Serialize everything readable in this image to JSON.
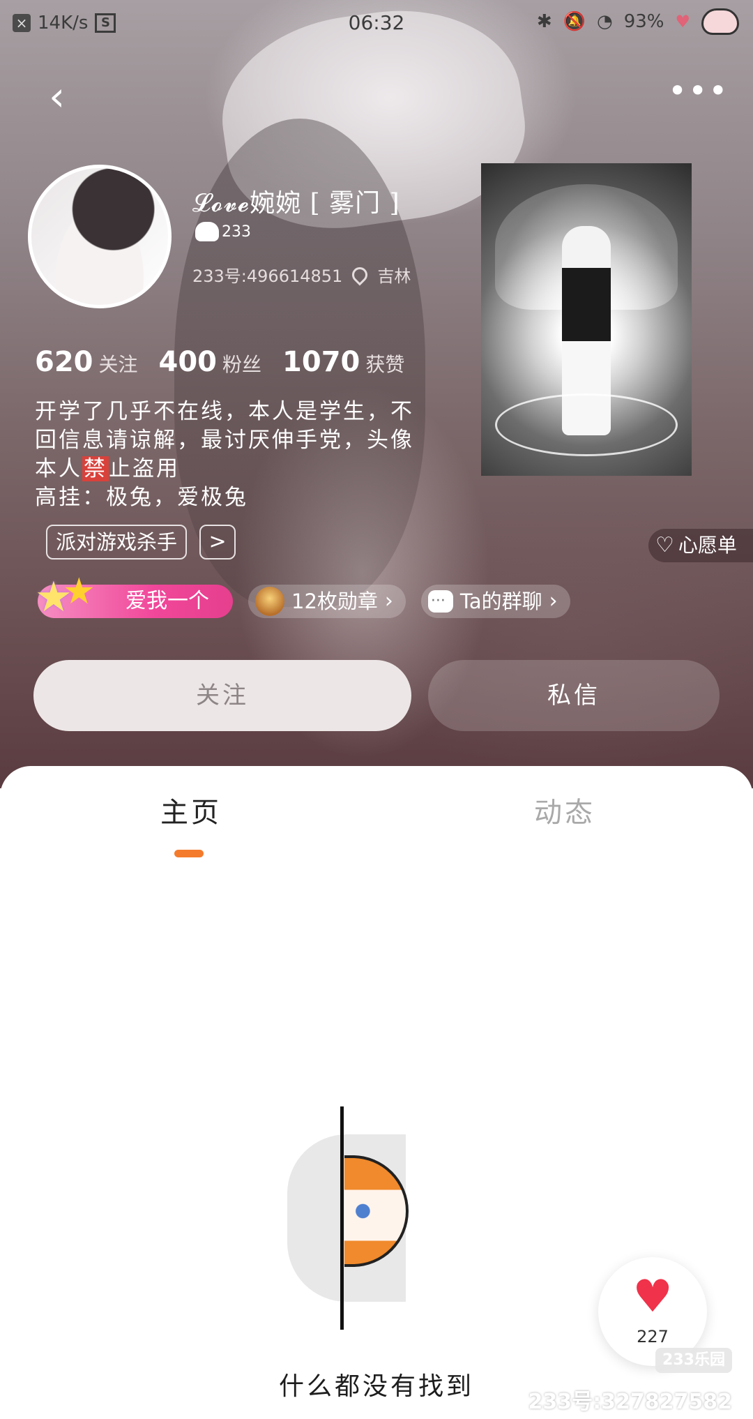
{
  "status_bar": {
    "net_speed": "14K/s",
    "time": "06:32",
    "battery": "93%"
  },
  "profile": {
    "username": "𝓛𝓸𝓿𝓮婉婉 [ 雾门 ]",
    "badge_text": "233",
    "uid": "233号:496614851",
    "location": "吉林",
    "stats": [
      {
        "value": "620",
        "label": "关注"
      },
      {
        "value": "400",
        "label": "粉丝"
      },
      {
        "value": "1070",
        "label": "获赞"
      }
    ],
    "bio_line1": "开学了几乎不在线，本人是学生，不",
    "bio_line2": "回信息请谅解，最讨厌伸手党，头像",
    "bio_line3_pre": "本人",
    "bio_line3_hl": "禁",
    "bio_line3_post": "止盗用",
    "bio_line4": "高挂：极兔，爱极兔",
    "tag": "派对游戏杀手",
    "tag_arrow": ">"
  },
  "wishlist_label": "心愿单",
  "chips": {
    "love": "爱我一个",
    "medals": "12枚勋章",
    "group_chat": "Ta的群聊"
  },
  "actions": {
    "follow": "关注",
    "message": "私信"
  },
  "tabs": [
    {
      "label": "主页",
      "active": true
    },
    {
      "label": "动态",
      "active": false
    }
  ],
  "empty_state": "什么都没有找到",
  "like_count": "227",
  "watermark": {
    "logo": "233乐园",
    "text": "233号:327827582"
  },
  "colors": {
    "accent": "#f47b2c",
    "like": "#f0324a",
    "love_chip": "#f1479a"
  }
}
